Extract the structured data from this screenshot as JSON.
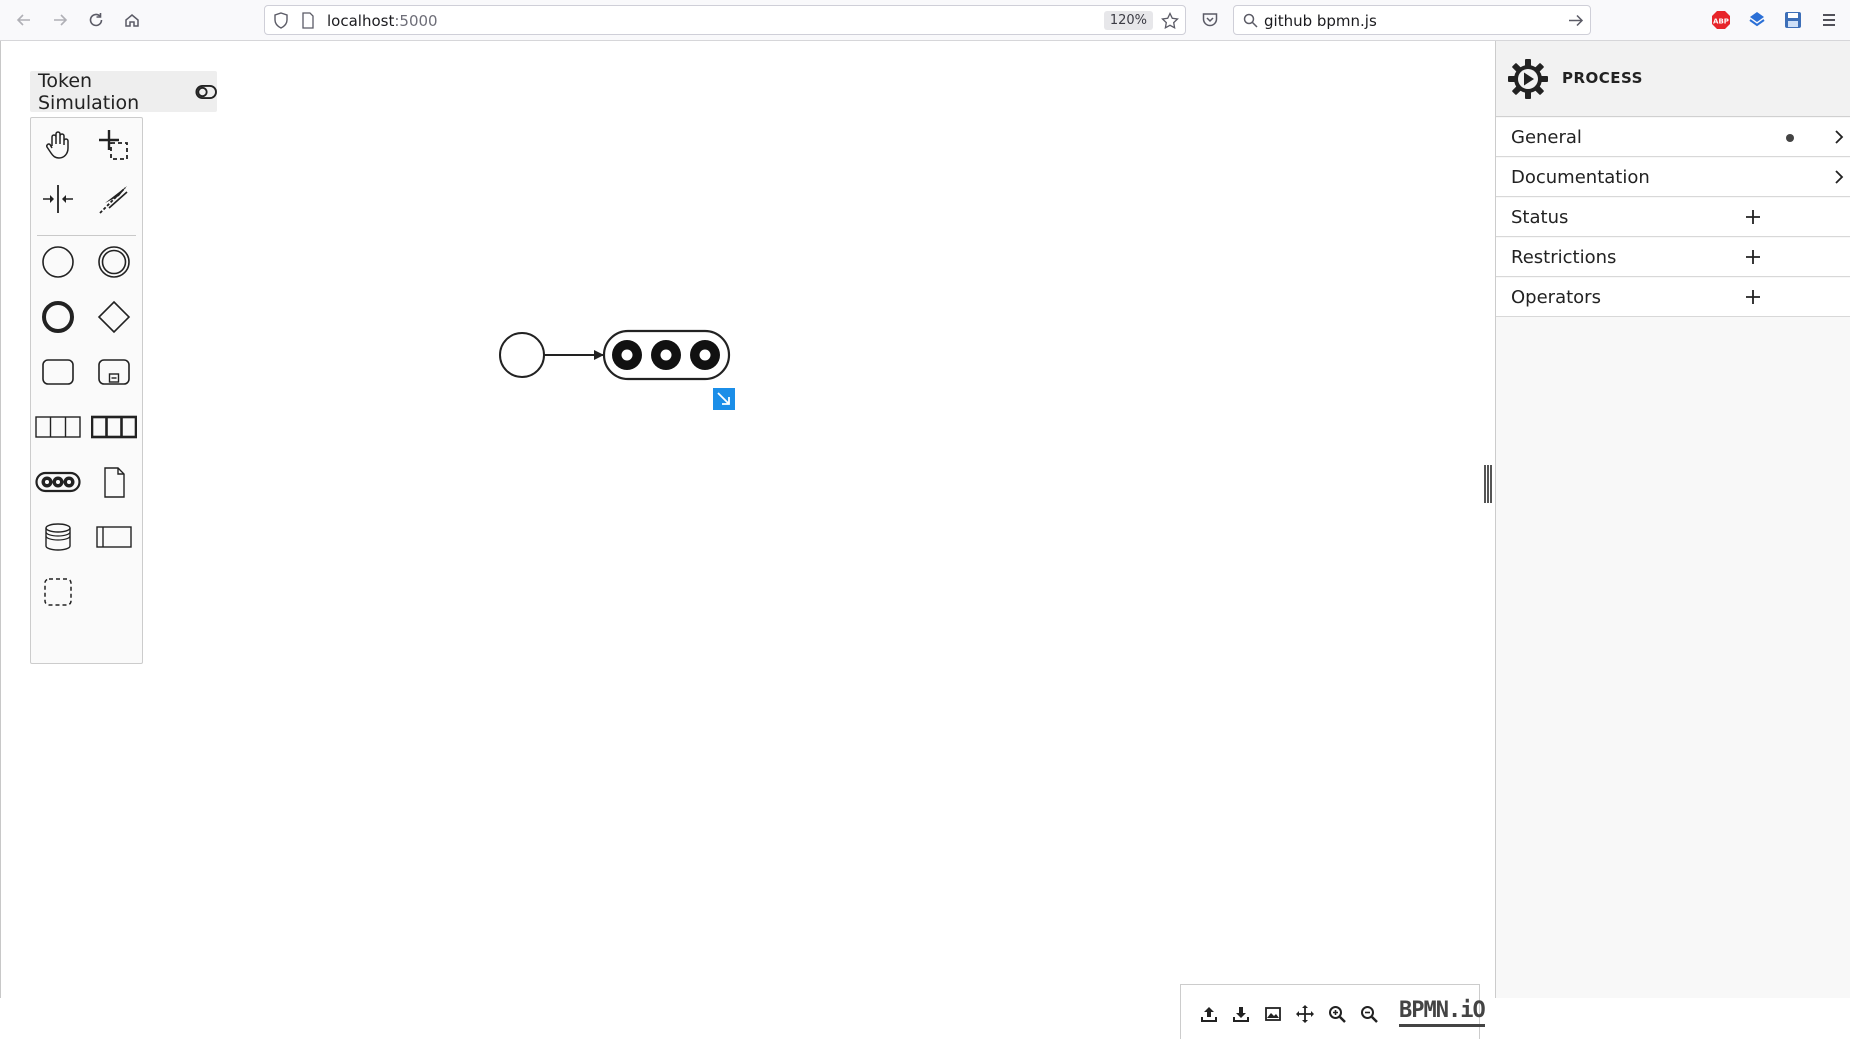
{
  "browser": {
    "url_host": "localhost",
    "url_port": ":5000",
    "zoom": "120%",
    "search_text": "github bpmn.js",
    "extensions": [
      "adblock-plus-icon",
      "extension-blue-icon",
      "save-page-icon"
    ]
  },
  "token_simulation": {
    "label": "Token Simulation"
  },
  "palette": {
    "tools": [
      "hand-tool-icon",
      "lasso-tool-icon",
      "space-tool-icon",
      "global-connect-tool-icon",
      "start-event-icon",
      "intermediate-event-icon",
      "end-event-icon",
      "gateway-icon",
      "task-icon",
      "subprocess-icon",
      "pool-icon",
      "lane-pool-icon",
      "custom-element-icon",
      "data-object-icon",
      "data-store-icon",
      "participant-icon",
      "group-icon"
    ]
  },
  "io_toolbar": {
    "buttons": [
      "upload-icon",
      "download-icon",
      "image-export-icon",
      "move-icon",
      "zoom-in-icon",
      "zoom-out-icon"
    ],
    "logo": "BPMN.iO"
  },
  "properties": {
    "title": "PROCESS",
    "groups": [
      {
        "label": "General",
        "indicator": "dot",
        "action": "chevron"
      },
      {
        "label": "Documentation",
        "action": "chevron"
      },
      {
        "label": "Status",
        "action": "plus"
      },
      {
        "label": "Restrictions",
        "action": "plus"
      },
      {
        "label": "Operators",
        "action": "plus"
      }
    ]
  },
  "colors": {
    "accent": "#1b8ee8",
    "panel_bg": "#f8f8f8",
    "border": "#cccccc"
  }
}
